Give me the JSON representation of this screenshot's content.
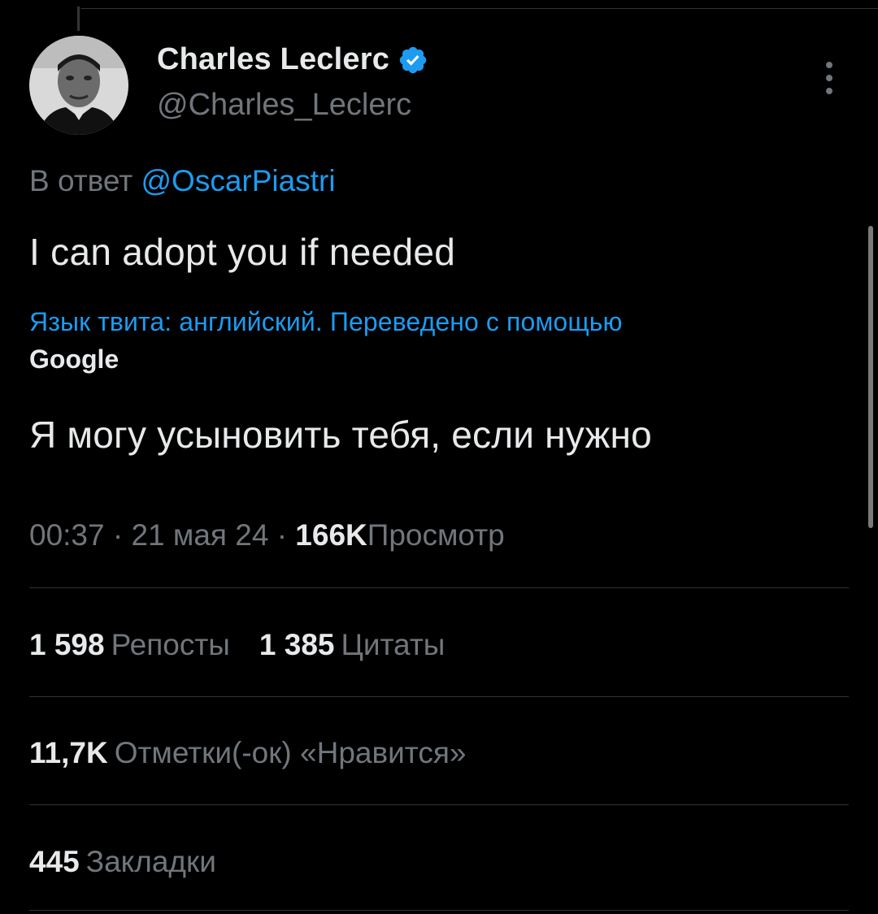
{
  "tweet": {
    "author": {
      "display_name": "Charles Leclerc",
      "handle": "@Charles_Leclerc",
      "verified": true,
      "verified_color": "#1d9bf0"
    },
    "reply_prefix": "В ответ",
    "reply_mention": "@OscarPiastri",
    "text": "I can adopt you if needed",
    "translation_note": "Язык твита: английский. Переведено с помощью",
    "translation_provider": "Google",
    "translated_text": "Я могу усыновить тебя, если нужно",
    "time": "00:37",
    "separator": "·",
    "date": "21 мая 24",
    "views_count": "166K",
    "views_label": "Просмотр"
  },
  "stats": {
    "reposts_count": "1 598",
    "reposts_label": "Репосты",
    "quotes_count": "1 385",
    "quotes_label": "Цитаты",
    "likes_count": "11,7K",
    "likes_label": "Отметки(-ок) «Нравится»",
    "bookmarks_count": "445",
    "bookmarks_label": "Закладки"
  },
  "icons": {
    "verified": "verified-badge-icon",
    "more": "more-vertical-icon"
  },
  "colors": {
    "background": "#000000",
    "primary_text": "#e7e9ea",
    "secondary_text": "#71767b",
    "accent": "#1d9bf0",
    "divider": "#2f3336"
  }
}
